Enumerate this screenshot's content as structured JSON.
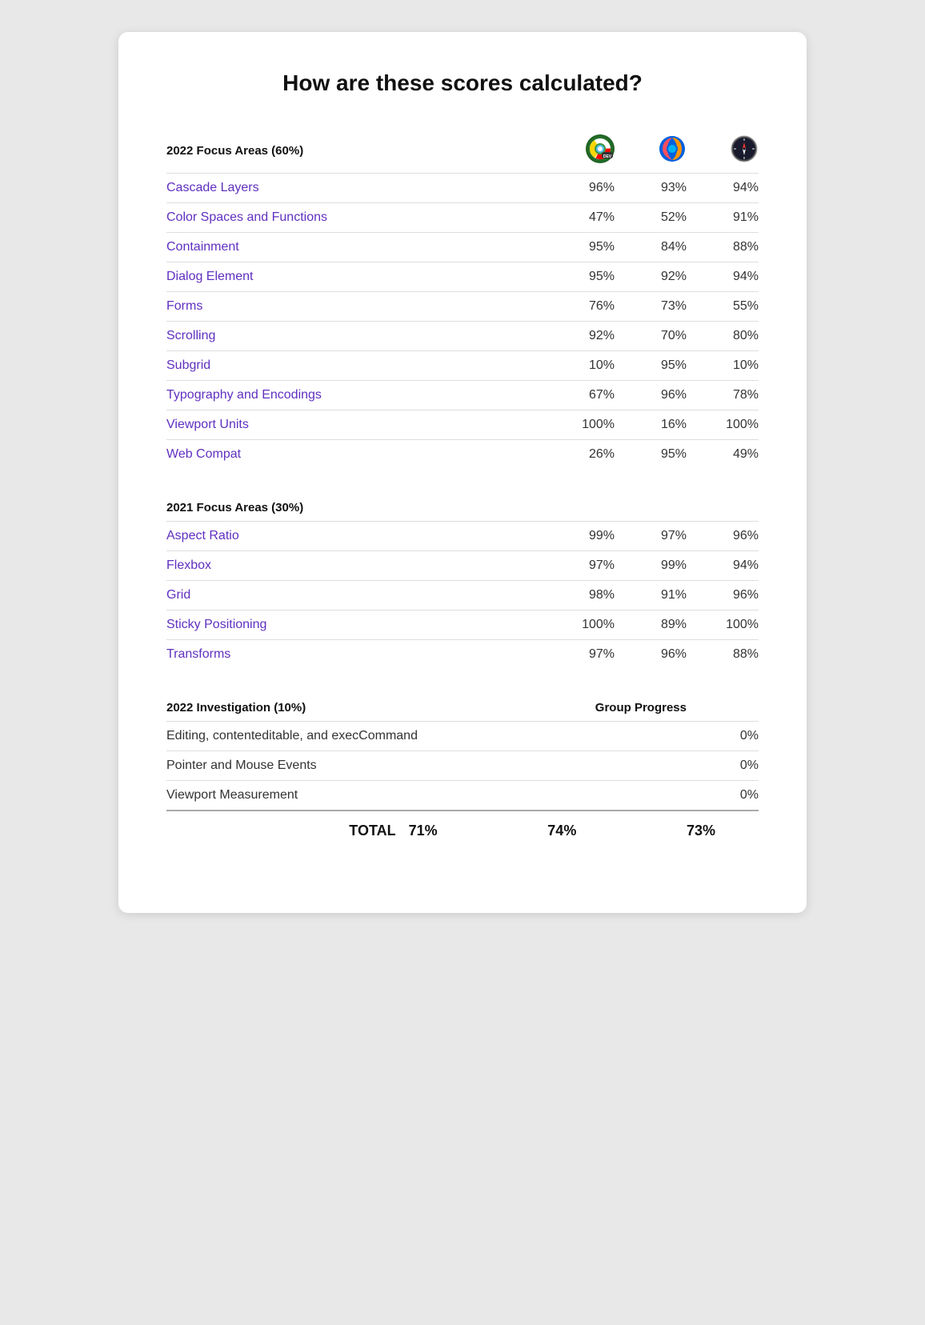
{
  "title": "How are these scores calculated?",
  "section2022": {
    "label": "2022 Focus Areas (60%)",
    "browsers": [
      "Chrome Dev",
      "Firefox",
      "Safari"
    ],
    "rows": [
      {
        "name": "Cascade Layers",
        "scores": [
          "96%",
          "93%",
          "94%"
        ]
      },
      {
        "name": "Color Spaces and Functions",
        "scores": [
          "47%",
          "52%",
          "91%"
        ]
      },
      {
        "name": "Containment",
        "scores": [
          "95%",
          "84%",
          "88%"
        ]
      },
      {
        "name": "Dialog Element",
        "scores": [
          "95%",
          "92%",
          "94%"
        ]
      },
      {
        "name": "Forms",
        "scores": [
          "76%",
          "73%",
          "55%"
        ]
      },
      {
        "name": "Scrolling",
        "scores": [
          "92%",
          "70%",
          "80%"
        ]
      },
      {
        "name": "Subgrid",
        "scores": [
          "10%",
          "95%",
          "10%"
        ]
      },
      {
        "name": "Typography and Encodings",
        "scores": [
          "67%",
          "96%",
          "78%"
        ]
      },
      {
        "name": "Viewport Units",
        "scores": [
          "100%",
          "16%",
          "100%"
        ]
      },
      {
        "name": "Web Compat",
        "scores": [
          "26%",
          "95%",
          "49%"
        ]
      }
    ]
  },
  "section2021": {
    "label": "2021 Focus Areas (30%)",
    "rows": [
      {
        "name": "Aspect Ratio",
        "scores": [
          "99%",
          "97%",
          "96%"
        ]
      },
      {
        "name": "Flexbox",
        "scores": [
          "97%",
          "99%",
          "94%"
        ]
      },
      {
        "name": "Grid",
        "scores": [
          "98%",
          "91%",
          "96%"
        ]
      },
      {
        "name": "Sticky Positioning",
        "scores": [
          "100%",
          "89%",
          "100%"
        ]
      },
      {
        "name": "Transforms",
        "scores": [
          "97%",
          "96%",
          "88%"
        ]
      }
    ]
  },
  "sectionInvestigation": {
    "label": "2022 Investigation (10%)",
    "group_progress_label": "Group Progress",
    "rows": [
      {
        "name": "Editing, contenteditable, and execCommand",
        "score": "0%"
      },
      {
        "name": "Pointer and Mouse Events",
        "score": "0%"
      },
      {
        "name": "Viewport Measurement",
        "score": "0%"
      }
    ]
  },
  "totalRow": {
    "label": "TOTAL",
    "scores": [
      "71%",
      "74%",
      "73%"
    ]
  }
}
